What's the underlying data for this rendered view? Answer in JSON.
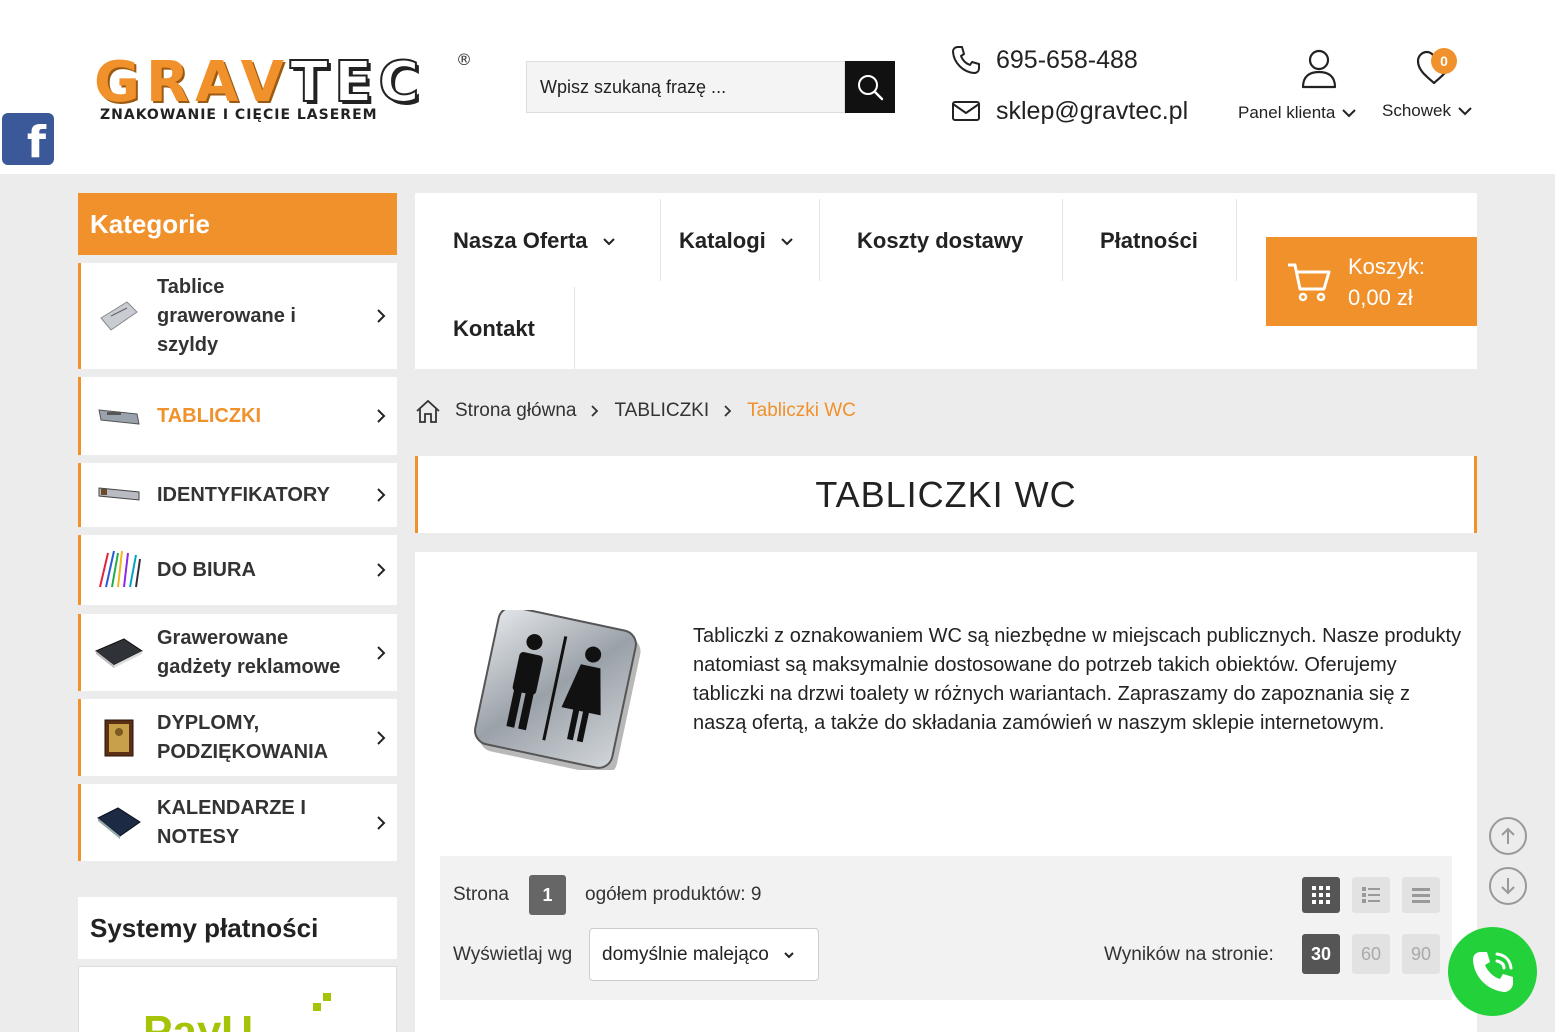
{
  "brand": {
    "logo_main_a": "GRAV",
    "logo_main_b": "TEC",
    "logo_reg": "®",
    "logo_sub": "ZNAKOWANIE I CIĘCIE LASEREM",
    "accent": "#f0912c"
  },
  "social": {
    "facebook_glyph": "f"
  },
  "search": {
    "placeholder": "Wpisz szukaną frazę ...",
    "icon": "search-icon"
  },
  "contact": {
    "phone": "695-658-488",
    "email": "sklep@gravtec.pl"
  },
  "account": {
    "panel_label": "Panel klienta",
    "wishlist_label": "Schowek",
    "wishlist_count": "0"
  },
  "sidebar": {
    "heading": "Kategorie",
    "items": [
      {
        "label": "Tablice grawerowane i szyldy",
        "active": false
      },
      {
        "label": "TABLICZKI",
        "active": true
      },
      {
        "label": "IDENTYFIKATORY",
        "active": false
      },
      {
        "label": "DO BIURA",
        "active": false
      },
      {
        "label": "Grawerowane gadżety reklamowe",
        "active": false
      },
      {
        "label": "DYPLOMY, PODZIĘKOWANIA",
        "active": false
      },
      {
        "label": "KALENDARZE I NOTESY",
        "active": false
      }
    ],
    "payments_heading": "Systemy płatności",
    "payments_logo_text": "PayU"
  },
  "nav": {
    "items": [
      "Nasza Oferta",
      "Katalogi",
      "Koszty dostawy",
      "Płatności",
      "Kontakt"
    ],
    "cart_label": "Koszyk:",
    "cart_total": "0,00 zł"
  },
  "breadcrumb": [
    "Strona główna",
    "TABLICZKI",
    "Tabliczki WC"
  ],
  "page": {
    "title": "TABLICZKI WC",
    "description": "Tabliczki z oznakowaniem WC są niezbędne w miejscach publicznych. Nasze produkty natomiast są maksymalnie dostosowane do potrzeb takich obiektów. Oferujemy tabliczki na drzwi toalety w różnych wariantach. Zapraszamy do zapoznania się z naszą ofertą, a także do składania zamówień w naszym sklepie internetowym."
  },
  "listing": {
    "page_label": "Strona",
    "page_number": "1",
    "total_label": "ogółem produktów: 9",
    "sort_label": "Wyświetlaj wg",
    "sort_value": "domyślnie malejąco",
    "per_page_label": "Wyników na stronie:",
    "per_page_options": [
      "30",
      "60",
      "90"
    ]
  }
}
